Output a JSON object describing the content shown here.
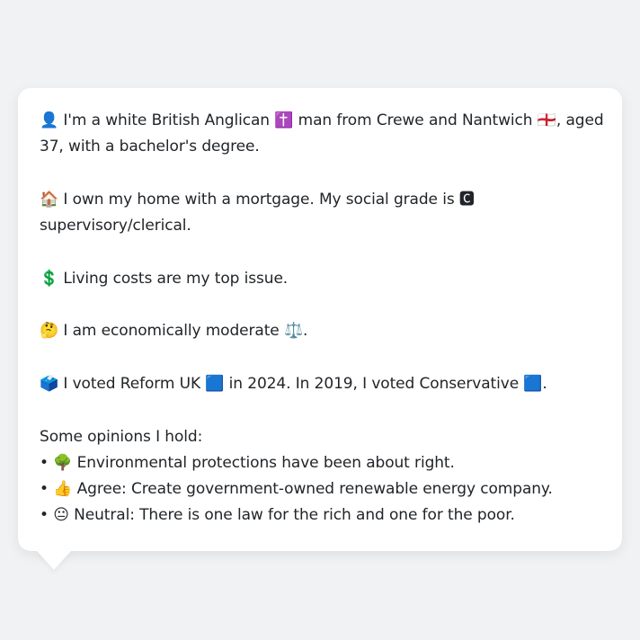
{
  "bubble": {
    "intro_line1": "👤 I'm a white British Anglican ✝️ man from Crewe and Nantwich 🏴󠁧󠁢󠁥󠁮󠁧󠁿, aged",
    "intro_line2": "37, with a bachelor's degree.",
    "home_line1": "🏠 I own my home with a mortgage. My social grade is 🅲",
    "home_line2": "supervisory/clerical.",
    "issue_line": "💲 Living costs are my top issue.",
    "economics_line": "🤔 I am economically moderate ⚖️.",
    "vote_line": "🗳️ I voted Reform UK 🟦 in 2024. In 2019, I voted Conservative 🟦.",
    "opinions_heading": "Some opinions I hold:",
    "opinions": [
      "• 🌳 Environmental protections have been about right.",
      "• 👍 Agree: Create government-owned renewable energy company.",
      "• 😐 Neutral: There is one law for the rich and one for the poor."
    ]
  }
}
